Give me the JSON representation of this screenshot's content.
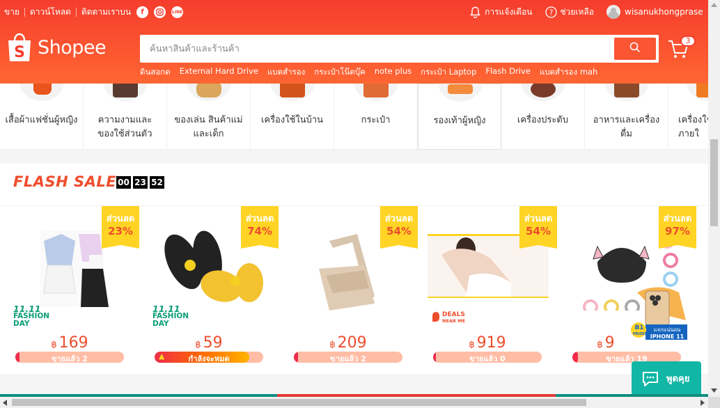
{
  "colors": {
    "brand": "#ee4d2d",
    "header_top": "#f53d2d",
    "header_bottom": "#ff6633",
    "badge": "#ffd424",
    "chat": "#12b6a5"
  },
  "topbar": {
    "left": [
      "ขาย",
      "ดาวน์โหลด",
      "ติดตามเราบน"
    ],
    "social": [
      "facebook-icon",
      "instagram-icon",
      "line-icon"
    ],
    "line_label": "LINE",
    "notifications": "การแจ้งเตือน",
    "help": "ช่วยเหลือ",
    "username": "wisanukhongprasert"
  },
  "header": {
    "logo_text": "Shopee",
    "search_placeholder": "ค้นหาสินค้าและร้านค้า",
    "cart_count": "3",
    "hotwords": [
      "ดินสอกด",
      "External Hard Drive",
      "แบตสำรอง",
      "กระเป๋าโน๊ตบุ๊ค",
      "note plus",
      "กระเป๋า Laptop",
      "Flash Drive",
      "แบตสำรอง mah"
    ]
  },
  "categories": [
    {
      "label": "เสื้อผ้าแฟชั่นผู้หญิง"
    },
    {
      "label": "ความงามและของใช้ส่วนตัว"
    },
    {
      "label": "ของเล่น สินค้าแม่และเด็ก"
    },
    {
      "label": "เครื่องใช้ในบ้าน"
    },
    {
      "label": "กระเป๋า"
    },
    {
      "label": "รองเท้าผู้หญิง"
    },
    {
      "label": "เครื่องประดับ"
    },
    {
      "label": "อาหารและเครื่องดื่ม"
    },
    {
      "label": "เครื่องใช้ภายใ"
    }
  ],
  "flash_sale": {
    "title": "FLASH SALE",
    "timer": [
      "00",
      "23",
      "52"
    ],
    "discount_label": "ส่วนลด",
    "currency": "฿",
    "products": [
      {
        "discount": "23%",
        "price": "169",
        "sold": "ขายแล้ว 2",
        "sold_fraction": 0.04,
        "tag": "1111"
      },
      {
        "discount": "74%",
        "price": "59",
        "sold": "กำลังจะหมด",
        "sold_fraction": 0.87,
        "tag": "1111"
      },
      {
        "discount": "54%",
        "price": "209",
        "sold": "ขายแล้ว 2",
        "sold_fraction": 0.04,
        "tag": ""
      },
      {
        "discount": "54%",
        "price": "919",
        "sold": "ขายแล้ว 0",
        "sold_fraction": 0.0,
        "tag": "deals"
      },
      {
        "discount": "97%",
        "price": "9",
        "sold": "ขายแล้ว 19",
        "sold_fraction": 0.05,
        "tag": ""
      }
    ],
    "tag_1111": {
      "line1": "11.11",
      "line2": "FASHION",
      "line3": "DAY"
    },
    "tag_deals": {
      "line1": "DEALS",
      "line2": "NEAR ME"
    }
  },
  "iphone_ad": {
    "line1": "แจกแน่นอน",
    "line2": "IPHONE 11",
    "chip": "B1",
    "chip2": "PRIZES"
  },
  "chat": {
    "label": "พูดคุย"
  }
}
